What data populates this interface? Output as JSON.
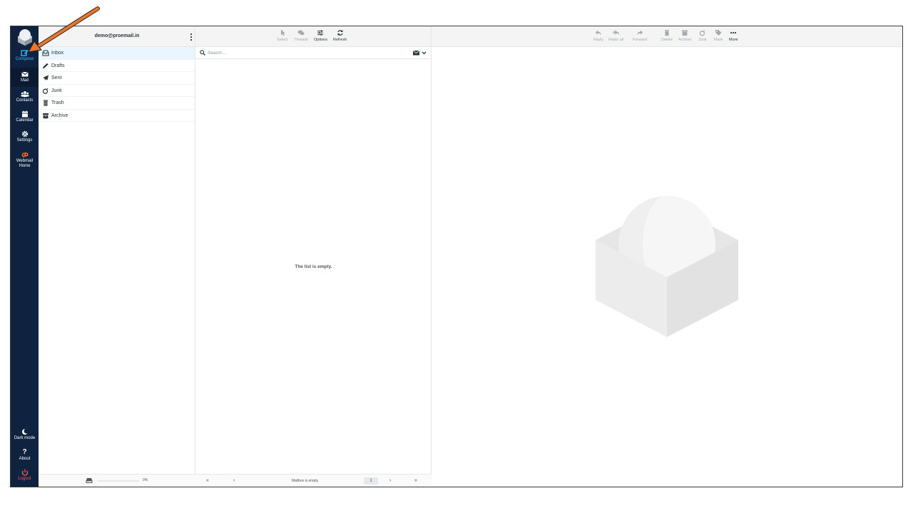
{
  "nav": {
    "compose": "Compose",
    "mail": "Mail",
    "contacts": "Contacts",
    "calendar": "Calendar",
    "settings": "Settings",
    "webmail_home_1": "Webmail",
    "webmail_home_2": "Home",
    "dark_mode": "Dark mode",
    "about": "About",
    "logout": "Logout"
  },
  "account": "demo@proemail.in",
  "folders": {
    "inbox": "Inbox",
    "drafts": "Drafts",
    "sent": "Sent",
    "junk": "Junk",
    "trash": "Trash",
    "archive": "Archive"
  },
  "quota_percent": "0%",
  "list_toolbar": {
    "select": "Select",
    "threads": "Threads",
    "options": "Options",
    "refresh": "Refresh"
  },
  "search": {
    "placeholder": "Search..."
  },
  "list_empty": "The list is empty.",
  "list_footer": {
    "first": "«",
    "prev": "‹",
    "status": "Mailbox is empty",
    "page": "1",
    "next": "›",
    "last": "»"
  },
  "message_toolbar": {
    "reply": "Reply",
    "reply_all": "Reply all",
    "forward": "Forward",
    "delete": "Delete",
    "archive": "Archive",
    "junk": "Junk",
    "mark": "Mark",
    "more": "More"
  },
  "colors": {
    "nav_bg": "#0f2341",
    "accent": "#37beff",
    "logout": "#ff5552",
    "annotation_arrow": "#e8772e"
  }
}
